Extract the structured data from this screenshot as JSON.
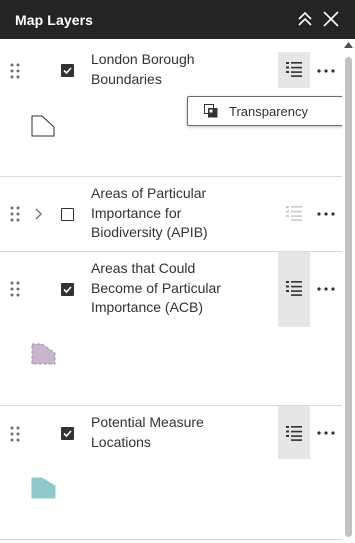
{
  "panel": {
    "title": "Map Layers",
    "collapse_icon": "collapse-up-icon",
    "close_icon": "close-icon"
  },
  "layers": [
    {
      "label": "London Borough Boundaries",
      "checked": true,
      "expandable": false,
      "legend_active": true,
      "swatch": "outline-polygon",
      "swatch_color": "#ffffff"
    },
    {
      "label": "Areas of Particular Importance for Biodiversity (APIB)",
      "checked": false,
      "expandable": true,
      "legend_active": false,
      "swatch": "none"
    },
    {
      "label": "Areas that Could Become of Particular Importance (ACB)",
      "checked": true,
      "expandable": false,
      "legend_active": true,
      "swatch": "dashed-polygon",
      "swatch_color": "#c8b6cc"
    },
    {
      "label": "Potential Measure Locations",
      "checked": true,
      "expandable": false,
      "legend_active": true,
      "swatch": "filled-polygon",
      "swatch_color": "#8fc9c9"
    }
  ],
  "popup": {
    "item_label": "Transparency",
    "item_icon": "transparency-icon"
  },
  "colors": {
    "header_bg": "#242424",
    "text": "#323232",
    "legend_active_bg": "#e6e6e6",
    "divider": "#d9d9d9"
  }
}
